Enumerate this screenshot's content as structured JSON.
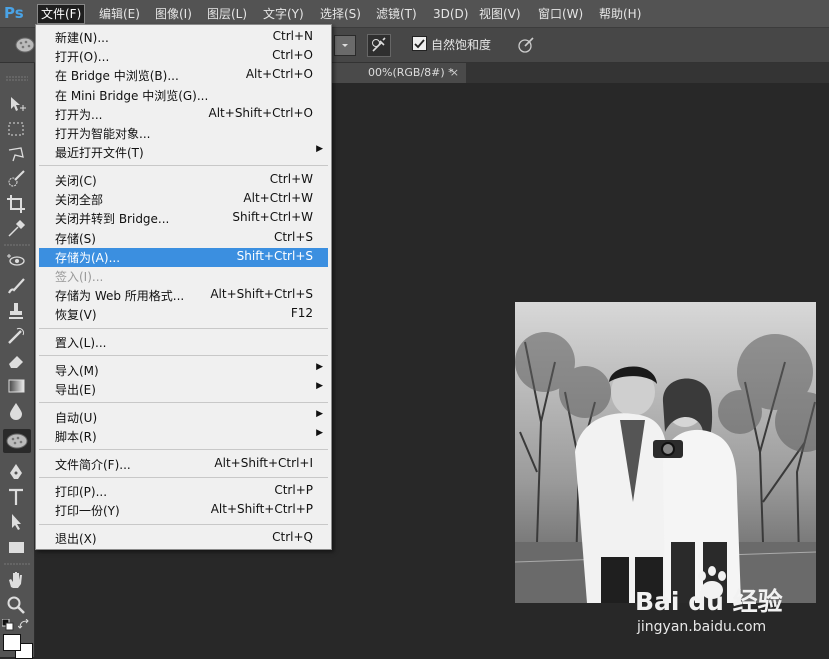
{
  "app_logo": "Ps",
  "menubar": [
    {
      "label": "文件(F)",
      "active": true
    },
    {
      "label": "编辑(E)"
    },
    {
      "label": "图像(I)"
    },
    {
      "label": "图层(L)"
    },
    {
      "label": "文字(Y)"
    },
    {
      "label": "选择(S)"
    },
    {
      "label": "滤镜(T)"
    },
    {
      "label": "3D(D)"
    },
    {
      "label": "视图(V)"
    },
    {
      "label": "窗口(W)"
    },
    {
      "label": "帮助(H)"
    }
  ],
  "options_bar": {
    "checkbox_label": "自然饱和度",
    "checkbox_checked": true
  },
  "document_tab": {
    "title": "00%(RGB/8#) *",
    "close": "×"
  },
  "file_menu": {
    "items": [
      {
        "label": "新建(N)...",
        "shortcut": "Ctrl+N"
      },
      {
        "label": "打开(O)...",
        "shortcut": "Ctrl+O"
      },
      {
        "label": "在 Bridge 中浏览(B)...",
        "shortcut": "Alt+Ctrl+O"
      },
      {
        "label": "在 Mini Bridge 中浏览(G)...",
        "shortcut": ""
      },
      {
        "label": "打开为...",
        "shortcut": "Alt+Shift+Ctrl+O"
      },
      {
        "label": "打开为智能对象...",
        "shortcut": ""
      },
      {
        "label": "最近打开文件(T)",
        "shortcut": "",
        "submenu": true
      },
      {
        "separator": true
      },
      {
        "label": "关闭(C)",
        "shortcut": "Ctrl+W"
      },
      {
        "label": "关闭全部",
        "shortcut": "Alt+Ctrl+W"
      },
      {
        "label": "关闭并转到 Bridge...",
        "shortcut": "Shift+Ctrl+W"
      },
      {
        "label": "存储(S)",
        "shortcut": "Ctrl+S"
      },
      {
        "label": "存储为(A)...",
        "shortcut": "Shift+Ctrl+S",
        "highlighted": true
      },
      {
        "label": "签入(I)...",
        "shortcut": "",
        "disabled": true
      },
      {
        "label": "存储为 Web 所用格式...",
        "shortcut": "Alt+Shift+Ctrl+S"
      },
      {
        "label": "恢复(V)",
        "shortcut": "F12"
      },
      {
        "separator": true
      },
      {
        "label": "置入(L)...",
        "shortcut": ""
      },
      {
        "separator": true
      },
      {
        "label": "导入(M)",
        "shortcut": "",
        "submenu": true
      },
      {
        "label": "导出(E)",
        "shortcut": "",
        "submenu": true
      },
      {
        "separator": true
      },
      {
        "label": "自动(U)",
        "shortcut": "",
        "submenu": true
      },
      {
        "label": "脚本(R)",
        "shortcut": "",
        "submenu": true
      },
      {
        "separator": true
      },
      {
        "label": "文件简介(F)...",
        "shortcut": "Alt+Shift+Ctrl+I"
      },
      {
        "separator": true
      },
      {
        "label": "打印(P)...",
        "shortcut": "Ctrl+P"
      },
      {
        "label": "打印一份(Y)",
        "shortcut": "Alt+Shift+Ctrl+P"
      },
      {
        "separator": true
      },
      {
        "label": "退出(X)",
        "shortcut": "Ctrl+Q"
      }
    ]
  },
  "watermark": {
    "brand": "Bai du 经验",
    "url": "jingyan.baidu.com"
  },
  "colors": {
    "highlight": "#3b8fe0",
    "menubar": "#535353",
    "canvas": "#282828"
  }
}
